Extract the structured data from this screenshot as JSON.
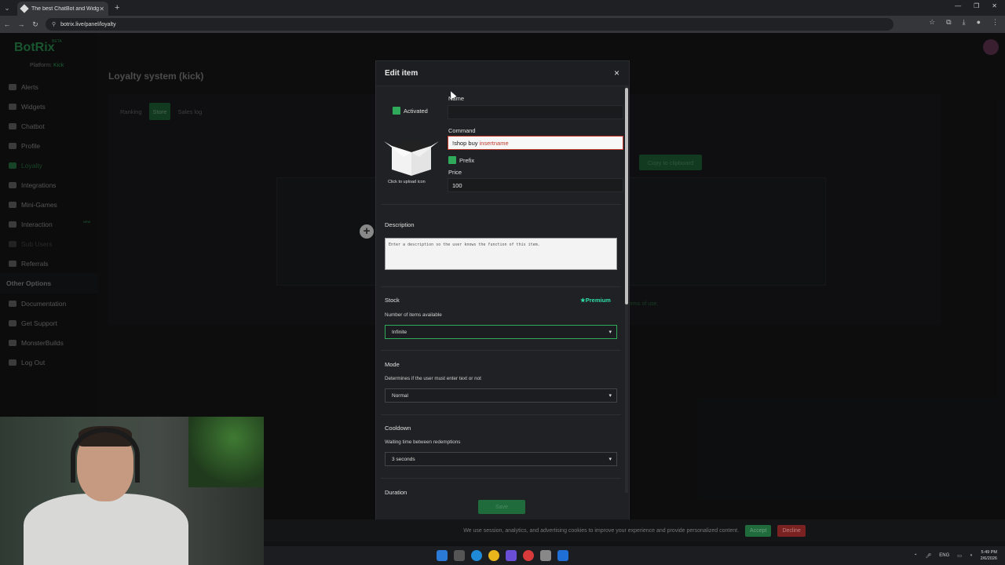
{
  "browser": {
    "tab_title": "The best ChatBot and Widgets",
    "url": "botrix.live/panel/loyalty"
  },
  "app": {
    "logo": "BotRix",
    "beta": "BETA",
    "platform_label": "Platform:",
    "platform_value": "Kick",
    "nav": [
      {
        "label": "Alerts"
      },
      {
        "label": "Widgets"
      },
      {
        "label": "Chatbot"
      },
      {
        "label": "Profile"
      },
      {
        "label": "Loyalty"
      },
      {
        "label": "Integrations"
      },
      {
        "label": "Mini-Games"
      },
      {
        "label": "Interaction",
        "badge": "NEW"
      },
      {
        "label": "Sub Users"
      },
      {
        "label": "Referrals"
      }
    ],
    "other_options_title": "Other Options",
    "other_nav": [
      {
        "label": "Documentation"
      },
      {
        "label": "Get Support"
      },
      {
        "label": "MonsterBuilds"
      },
      {
        "label": "Log Out"
      }
    ],
    "page_title": "Loyalty system (kick)",
    "tabs": [
      "Ranking",
      "Store",
      "Sales log"
    ],
    "copy_button": "Copy to clipboard",
    "terms_text": "terms of use."
  },
  "modal": {
    "title": "Edit item",
    "close": "×",
    "activated_label": "Activated",
    "name_label": "Name",
    "name_value": "",
    "command_label": "Command",
    "command_prefix": "!shop buy",
    "command_hint": "insertname",
    "prefix_label": "Prefix",
    "price_label": "Price",
    "price_value": "100",
    "upload_label": "Click to upload icon",
    "description_label": "Description",
    "description_placeholder": "Enter a description so the user knows the function of this item.",
    "stock_label": "Stock",
    "premium_label": "Premium",
    "stock_sub": "Number of items available",
    "stock_value": "Infinite",
    "mode_label": "Mode",
    "mode_sub": "Determines if the user must enter text or not",
    "mode_value": "Normal",
    "cooldown_label": "Cooldown",
    "cooldown_sub": "Waiting time between redemptions",
    "cooldown_value": "3 seconds",
    "duration_label": "Duration",
    "save_button": "Save"
  },
  "cookie": {
    "text": "We use session, analytics, and advertising cookies to improve your experience and provide personalized content.",
    "accept": "Accept",
    "decline": "Decline"
  },
  "taskbar": {
    "lang": "ENG",
    "time": "5:49 PM",
    "date": "2/6/2026"
  }
}
